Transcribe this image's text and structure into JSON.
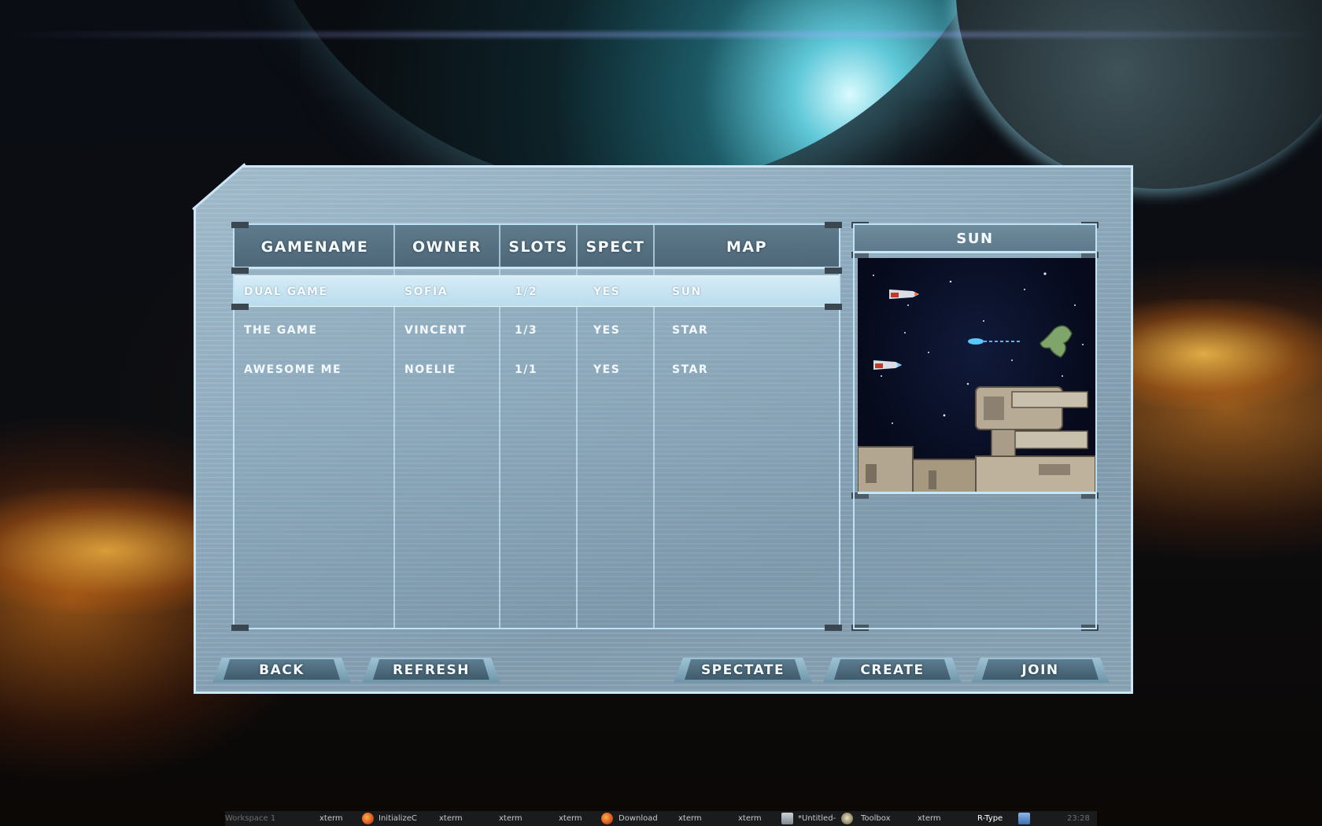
{
  "window": {
    "title": "R-Type"
  },
  "game_list": {
    "columns": [
      "GAMENAME",
      "OWNER",
      "SLOTS",
      "SPECT",
      "MAP"
    ],
    "rows": [
      {
        "gamename": "DUAL GAME",
        "owner": "SOFIA",
        "slots": "1/2",
        "spect": "YES",
        "map": "SUN",
        "selected": true
      },
      {
        "gamename": "THE GAME",
        "owner": "VINCENT",
        "slots": "1/3",
        "spect": "YES",
        "map": "STAR",
        "selected": false
      },
      {
        "gamename": "AWESOME ME",
        "owner": "NOELIE",
        "slots": "1/1",
        "spect": "YES",
        "map": "STAR",
        "selected": false
      }
    ]
  },
  "map_preview": {
    "title": "SUN"
  },
  "buttons": {
    "back": "BACK",
    "refresh": "REFRESH",
    "spectate": "SPECTATE",
    "create": "CREATE",
    "join": "JOIN"
  },
  "taskbar": {
    "workspace": "Workspace 1",
    "items": [
      {
        "label": "xterm",
        "icon": "terminal-icon"
      },
      {
        "label": "InitializeC",
        "icon": "firefox-icon"
      },
      {
        "label": "xterm",
        "icon": "terminal-icon"
      },
      {
        "label": "xterm",
        "icon": "terminal-icon"
      },
      {
        "label": "xterm",
        "icon": "terminal-icon"
      },
      {
        "label": "Download",
        "icon": "firefox-icon"
      },
      {
        "label": "xterm",
        "icon": "terminal-icon"
      },
      {
        "label": "xterm",
        "icon": "terminal-icon"
      },
      {
        "label": "*Untitled-",
        "icon": "gimp-icon"
      },
      {
        "label": "Toolbox",
        "icon": "gimp-icon"
      },
      {
        "label": "xterm",
        "icon": "terminal-icon"
      },
      {
        "label": "R-Type",
        "icon": "game-icon"
      }
    ],
    "clock": "23:28"
  },
  "colors": {
    "panel": "#8eaabd",
    "panel_border": "#cde7f7",
    "header": "#5f7b8c",
    "selected_row": "#c8e4f2",
    "button": "#4d6b7e"
  }
}
